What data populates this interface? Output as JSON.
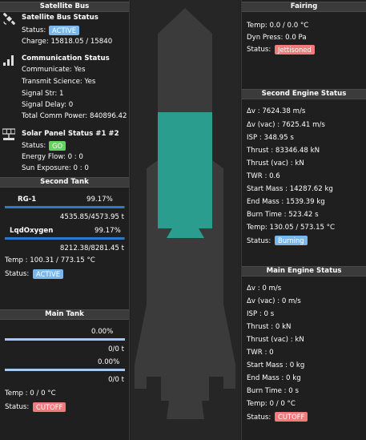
{
  "satellite_bus": {
    "header": "Satellite Bus",
    "status_title": "Satellite Bus Status",
    "status_label": "Status:",
    "status_badge": "ACTIVE",
    "charge": "Charge: 15818.05 / 15840",
    "comm_title": "Communication Status",
    "communicate": "Communicate: Yes",
    "transmit": "Transmit Science: Yes",
    "signal_str": "Signal Str: 1",
    "signal_delay": "Signal Delay: 0",
    "total_comm_power": "Total Comm Power: 840896.42",
    "solar_title": "Solar Panel Status #1 #2",
    "solar_status_label": "Status:",
    "solar_status_badge": "GO",
    "energy_flow": "Energy Flow: 0 : 0",
    "sun_exposure": "Sun Exposure: 0 : 0"
  },
  "second_tank": {
    "header": "Second Tank",
    "fuel1_name": "RG-1",
    "fuel1_pct": "99.17%",
    "fuel1_fill": 0.9917,
    "fuel1_amount": "4535.85/4573.95 t",
    "fuel2_name": "LqdOxygen",
    "fuel2_pct": "99.17%",
    "fuel2_fill": 0.9917,
    "fuel2_amount": "8212.38/8281.45 t",
    "temp": "Temp : 100.31 / 773.15 °C",
    "status_label": "Status:",
    "status_badge": "ACTIVE"
  },
  "main_tank": {
    "header": "Main Tank",
    "fuel1_pct": "0.00%",
    "fuel1_fill": 0,
    "fuel1_amount": "0/0 t",
    "fuel2_pct": "0.00%",
    "fuel2_fill": 0,
    "fuel2_amount": "0/0 t",
    "temp": "Temp : 0 / 0 °C",
    "status_label": "Status:",
    "status_badge": "CUTOFF"
  },
  "fairing": {
    "header": "Fairing",
    "temp": "Temp: 0.0 / 0.0 °C",
    "dyn_press": "Dyn Press: 0.0 Pa",
    "status_label": "Status:",
    "status_badge": "Jettisoned"
  },
  "second_engine": {
    "header": "Second Engine Status",
    "dv": "Δv : 7624.38 m/s",
    "dv_vac": "Δv (vac) : 7625.41 m/s",
    "isp": "ISP : 348.95 s",
    "thrust": "Thrust : 83346.48 kN",
    "thrust_vac": "Thrust (vac) : kN",
    "twr": "TWR : 0.6",
    "start_mass": "Start Mass : 14287.62 kg",
    "end_mass": "End Mass : 1539.39 kg",
    "burn_time": "Burn Time : 523.42 s",
    "temp": "Temp: 130.05 / 573.15 °C",
    "status_label": "Status:",
    "status_badge": "Burning"
  },
  "main_engine": {
    "header": "Main Engine Status",
    "dv": "Δv : 0 m/s",
    "dv_vac": "Δv (vac) : 0 m/s",
    "isp": "ISP : 0 s",
    "thrust": "Thrust : 0 kN",
    "thrust_vac": "Thrust (vac) : kN",
    "twr": "TWR : 0",
    "start_mass": "Start Mass : 0 kg",
    "end_mass": "End Mass : 0 kg",
    "burn_time": "Burn Time : 0 s",
    "temp": "Temp: 0 / 0 °C",
    "status_label": "Status:",
    "status_badge": "CUTOFF"
  },
  "colors": {
    "bar_blue": "#2f78d2",
    "bar_light": "#a9c8ec",
    "active_stage": "#2a9d8f",
    "rocket_body": "#3b3b3c"
  },
  "icons": [
    "satellite-icon",
    "signal-bars-icon",
    "solar-panel-icon"
  ]
}
